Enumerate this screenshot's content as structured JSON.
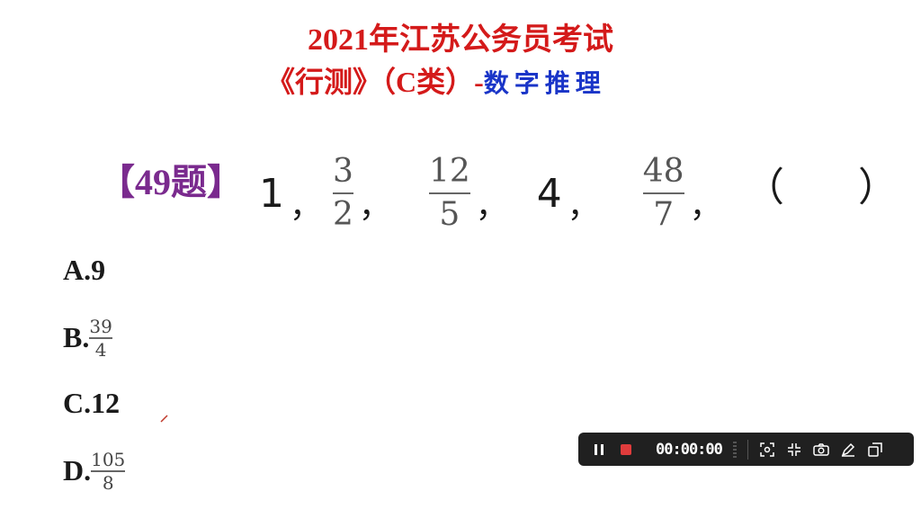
{
  "header": {
    "title": "2021年江苏公务员考试",
    "subtitle": "《行测》（C类）-",
    "subtitle_topic": "数字推理"
  },
  "question": {
    "label": "【49题】",
    "sequence": {
      "t1": "1",
      "f1_num": "3",
      "f1_den": "2",
      "f2_num": "12",
      "f2_den": "5",
      "t4": "4",
      "f3_num": "48",
      "f3_den": "7",
      "comma": "，"
    },
    "answer_blank": "（ ）"
  },
  "options": {
    "a": "A.9",
    "b_prefix": "B.",
    "b_num": "39",
    "b_den": "4",
    "c": "C.12",
    "d_prefix": "D.",
    "d_num": "105",
    "d_den": "8"
  },
  "recorder": {
    "time": "00:00:00",
    "icons": [
      "pause-icon",
      "stop-icon",
      "region-icon",
      "shrink-icon",
      "camera-icon",
      "pen-icon",
      "window-icon"
    ],
    "colors": {
      "stop": "#e03c3c",
      "bar": "#202020"
    }
  }
}
